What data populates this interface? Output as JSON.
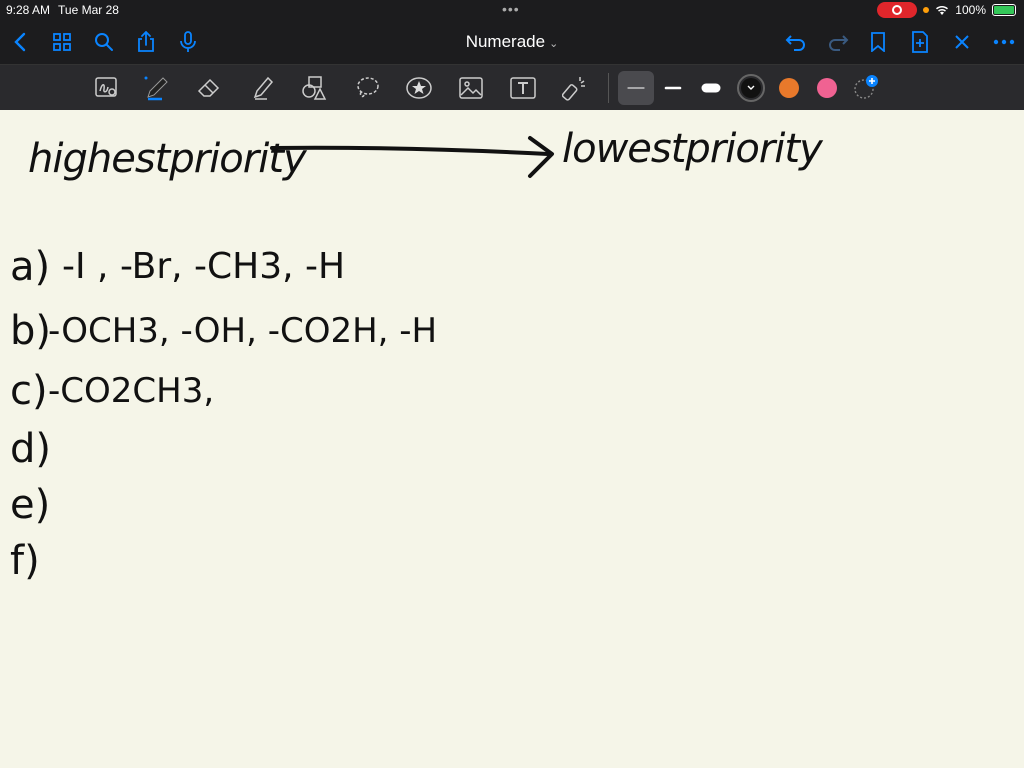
{
  "status": {
    "time": "9:28 AM",
    "date": "Tue Mar 28",
    "battery": "100%"
  },
  "nav": {
    "title": "Numerade",
    "icons": [
      "back-chevron-icon",
      "grid-icon",
      "search-icon",
      "share-icon",
      "microphone-icon",
      "undo-icon",
      "redo-icon",
      "bookmark-icon",
      "add-page-icon",
      "close-icon",
      "more-icon"
    ]
  },
  "toolbar": {
    "tools": [
      "lasso-zoom-icon",
      "pen-icon",
      "eraser-icon",
      "highlighter-icon",
      "shapes-icon",
      "lasso-icon",
      "sticker-icon",
      "image-icon",
      "text-icon",
      "laser-pointer-icon"
    ],
    "colors": {
      "black": "#111111",
      "orange": "#e8792b",
      "pink": "#f06292"
    }
  },
  "notes": {
    "left_label": "highestpriority",
    "right_label": "lowestpriority",
    "items": [
      {
        "letter": "a)",
        "text": "-I , -Br, -CH3, -H"
      },
      {
        "letter": "b)",
        "text": "-OCH3, -OH, -CO2H, -H"
      },
      {
        "letter": "c)",
        "text": "-CO2CH3,"
      },
      {
        "letter": "d)",
        "text": ""
      },
      {
        "letter": "e)",
        "text": ""
      },
      {
        "letter": "f)",
        "text": ""
      }
    ]
  }
}
